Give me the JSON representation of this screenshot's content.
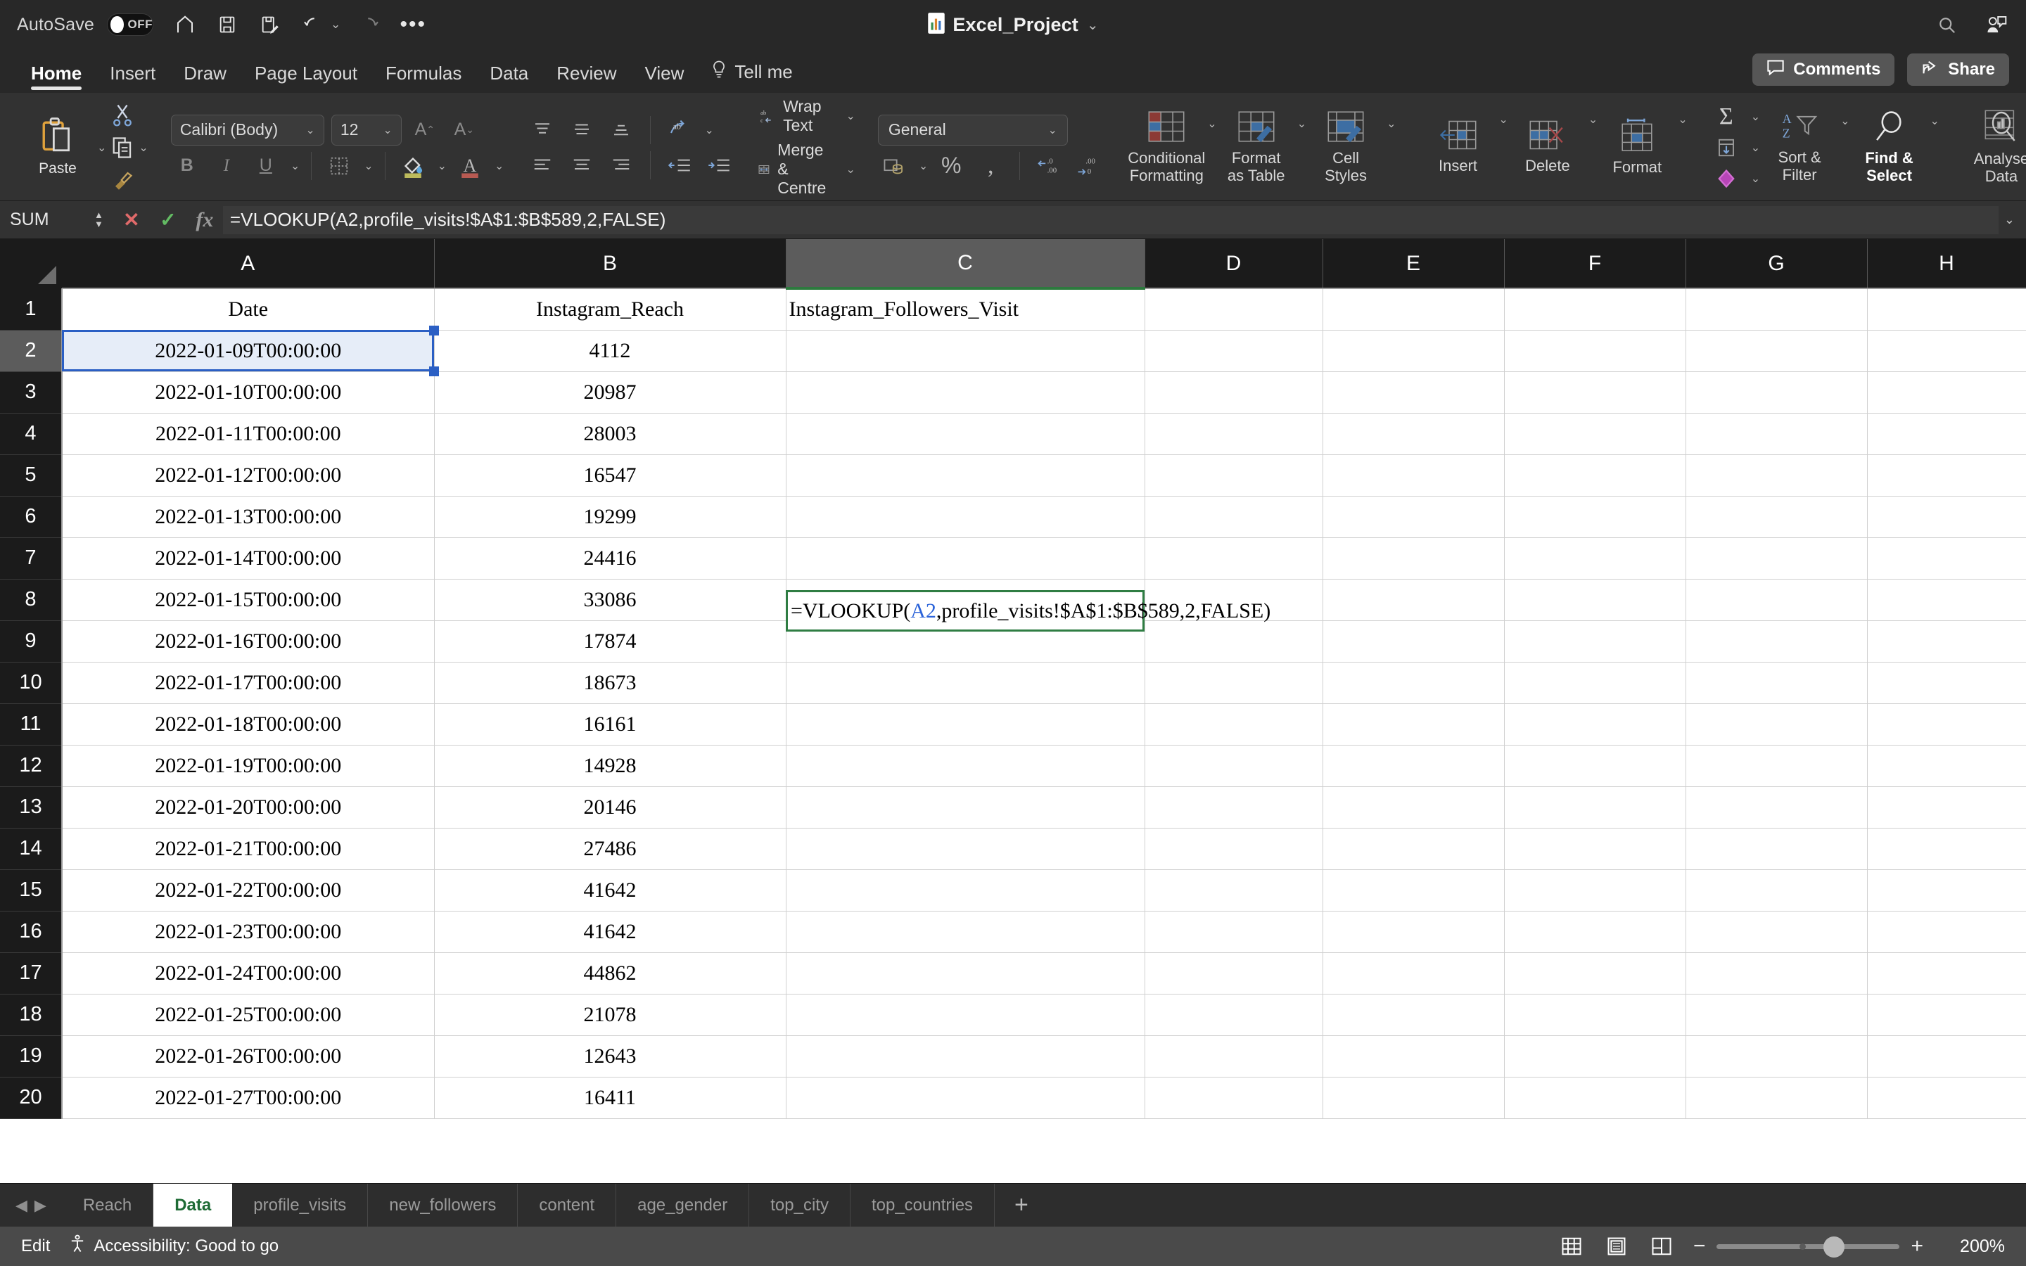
{
  "titlebar": {
    "autosave_label": "AutoSave",
    "autosave_state": "OFF",
    "doc_title": "Excel_Project",
    "quick_access": [
      {
        "name": "home-icon",
        "label": "Home"
      },
      {
        "name": "save-icon",
        "label": "Save"
      },
      {
        "name": "save-as-icon",
        "label": "Save As"
      },
      {
        "name": "undo-icon",
        "label": "Undo"
      },
      {
        "name": "redo-icon",
        "label": "Redo"
      },
      {
        "name": "more-options-icon",
        "label": "More"
      }
    ],
    "search_icon": "search-icon",
    "account_icon": "account-comments-icon"
  },
  "ribbon_tabs": {
    "items": [
      {
        "label": "Home",
        "active": true
      },
      {
        "label": "Insert",
        "active": false
      },
      {
        "label": "Draw",
        "active": false
      },
      {
        "label": "Page Layout",
        "active": false
      },
      {
        "label": "Formulas",
        "active": false
      },
      {
        "label": "Data",
        "active": false
      },
      {
        "label": "Review",
        "active": false
      },
      {
        "label": "View",
        "active": false
      }
    ],
    "tell_me": "Tell me",
    "comments": "Comments",
    "share": "Share"
  },
  "ribbon": {
    "paste_label": "Paste",
    "font_name": "Calibri (Body)",
    "font_size": "12",
    "grow_font": "A",
    "shrink_font": "A",
    "bold": "B",
    "italic": "I",
    "underline": "U",
    "wrap_text": "Wrap Text",
    "merge_centre": "Merge & Centre",
    "number_format": "General",
    "percent": "%",
    "comma": ",",
    "conditional_formatting": "Conditional\nFormatting",
    "conditional_formatting_l1": "Conditional",
    "conditional_formatting_l2": "Formatting",
    "format_as_table_l1": "Format",
    "format_as_table_l2": "as Table",
    "cell_styles_l1": "Cell",
    "cell_styles_l2": "Styles",
    "insert": "Insert",
    "delete": "Delete",
    "format": "Format",
    "sort_filter_l1": "Sort &",
    "sort_filter_l2": "Filter",
    "find_select_l1": "Find &",
    "find_select_l2": "Select",
    "analyse_data_l1": "Analyse",
    "analyse_data_l2": "Data"
  },
  "formula_bar": {
    "name_box": "SUM",
    "cancel_icon": "cancel-icon",
    "enter_icon": "enter-icon",
    "fx_icon": "fx-icon",
    "formula": "=VLOOKUP(A2,profile_visits!$A$1:$B$589,2,FALSE)"
  },
  "grid": {
    "columns": [
      "A",
      "B",
      "C",
      "D",
      "E",
      "F",
      "G",
      "H"
    ],
    "selected_column": "C",
    "rows": [
      "1",
      "2",
      "3",
      "4",
      "5",
      "6",
      "7",
      "8",
      "9",
      "10",
      "11",
      "12",
      "13",
      "14",
      "15",
      "16",
      "17",
      "18",
      "19",
      "20"
    ],
    "selected_row": "2",
    "data": [
      [
        "Date",
        "Instagram_Reach",
        "Instagram_Followers_Visit"
      ],
      [
        "2022-01-09T00:00:00",
        "4112",
        ""
      ],
      [
        "2022-01-10T00:00:00",
        "20987",
        ""
      ],
      [
        "2022-01-11T00:00:00",
        "28003",
        ""
      ],
      [
        "2022-01-12T00:00:00",
        "16547",
        ""
      ],
      [
        "2022-01-13T00:00:00",
        "19299",
        ""
      ],
      [
        "2022-01-14T00:00:00",
        "24416",
        ""
      ],
      [
        "2022-01-15T00:00:00",
        "33086",
        ""
      ],
      [
        "2022-01-16T00:00:00",
        "17874",
        ""
      ],
      [
        "2022-01-17T00:00:00",
        "18673",
        ""
      ],
      [
        "2022-01-18T00:00:00",
        "16161",
        ""
      ],
      [
        "2022-01-19T00:00:00",
        "14928",
        ""
      ],
      [
        "2022-01-20T00:00:00",
        "20146",
        ""
      ],
      [
        "2022-01-21T00:00:00",
        "27486",
        ""
      ],
      [
        "2022-01-22T00:00:00",
        "41642",
        ""
      ],
      [
        "2022-01-23T00:00:00",
        "41642",
        ""
      ],
      [
        "2022-01-24T00:00:00",
        "44862",
        ""
      ],
      [
        "2022-01-25T00:00:00",
        "21078",
        ""
      ],
      [
        "2022-01-26T00:00:00",
        "12643",
        ""
      ],
      [
        "2022-01-27T00:00:00",
        "16411",
        ""
      ]
    ],
    "editing_cell": {
      "address": "C2",
      "prefix": "=VLOOKUP(",
      "reference": "A2",
      "suffix": ",profile_visits!$A$1:$B$589,2,FALSE)"
    }
  },
  "sheet_tabs": {
    "items": [
      {
        "label": "Reach",
        "active": false
      },
      {
        "label": "Data",
        "active": true
      },
      {
        "label": "profile_visits",
        "active": false
      },
      {
        "label": "new_followers",
        "active": false
      },
      {
        "label": "content",
        "active": false
      },
      {
        "label": "age_gender",
        "active": false
      },
      {
        "label": "top_city",
        "active": false
      },
      {
        "label": "top_countries",
        "active": false
      }
    ],
    "add_label": "+"
  },
  "status_bar": {
    "mode": "Edit",
    "accessibility": "Accessibility: Good to go",
    "zoom_level": "200%",
    "zoom_minus": "−",
    "zoom_plus": "+"
  }
}
